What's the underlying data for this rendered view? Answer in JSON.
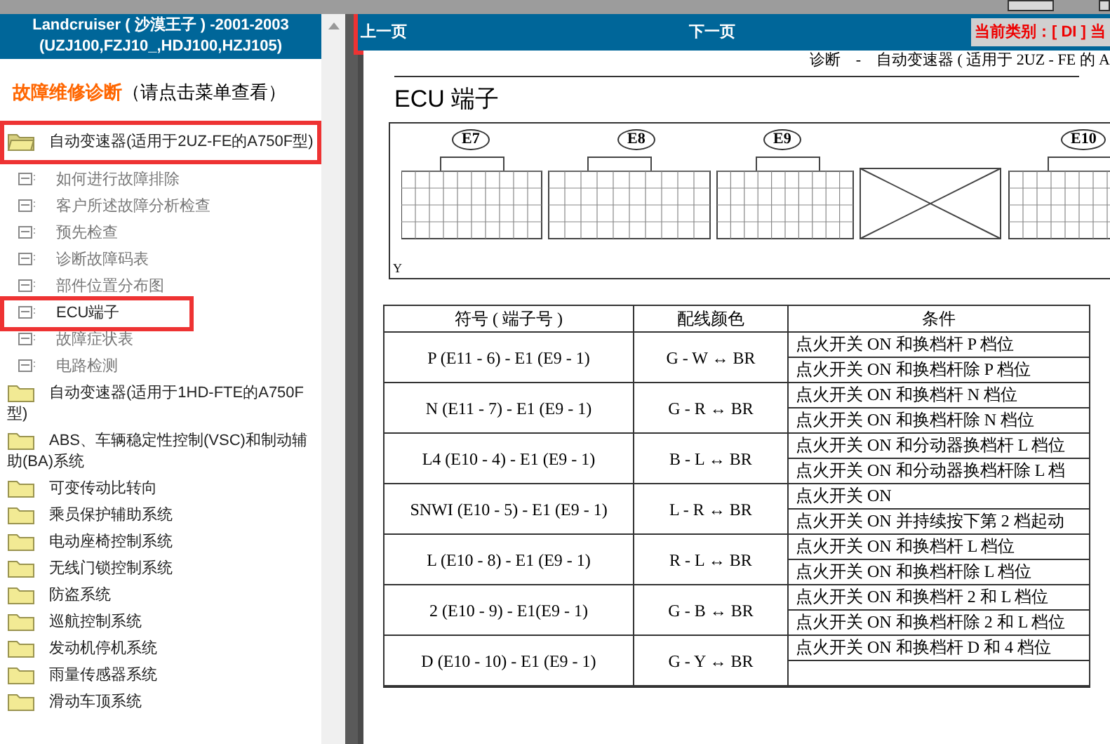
{
  "sidebar": {
    "title_lines": [
      "Landcruiser ( 沙漠王子 ) -2001-2003",
      "(UZJ100,FZJ10_,HDJ100,HZJ105)"
    ],
    "heading": "故障维修诊断",
    "heading_hint": "（请点击菜单查看）",
    "items": [
      {
        "label": "自动变速器(适用于2UZ-FE的A750F型)",
        "expanded": true,
        "highlighted": true,
        "children": [
          {
            "label": "如何进行故障排除",
            "highlighted": false
          },
          {
            "label": "客户所述故障分析检查",
            "highlighted": false
          },
          {
            "label": "预先检查",
            "highlighted": false
          },
          {
            "label": "诊断故障码表",
            "highlighted": false
          },
          {
            "label": "部件位置分布图",
            "highlighted": false
          },
          {
            "label": "ECU端子",
            "highlighted": true
          },
          {
            "label": "故障症状表",
            "highlighted": false
          },
          {
            "label": "电路检测",
            "highlighted": false
          }
        ]
      },
      {
        "label": "自动变速器(适用于1HD-FTE的A750F型)",
        "expanded": false,
        "highlighted": false
      },
      {
        "label": "ABS、车辆稳定性控制(VSC)和制动辅助(BA)系统",
        "expanded": false,
        "highlighted": false
      },
      {
        "label": "可变传动比转向",
        "expanded": false,
        "highlighted": false
      },
      {
        "label": "乘员保护辅助系统",
        "expanded": false,
        "highlighted": false
      },
      {
        "label": "电动座椅控制系统",
        "expanded": false,
        "highlighted": false
      },
      {
        "label": "无线门锁控制系统",
        "expanded": false,
        "highlighted": false
      },
      {
        "label": "防盗系统",
        "expanded": false,
        "highlighted": false
      },
      {
        "label": "巡航控制系统",
        "expanded": false,
        "highlighted": false
      },
      {
        "label": "发动机停机系统",
        "expanded": false,
        "highlighted": false
      },
      {
        "label": "雨量传感器系统",
        "expanded": false,
        "highlighted": false
      },
      {
        "label": "滑动车顶系统",
        "expanded": false,
        "highlighted": false
      }
    ]
  },
  "nav": {
    "prev": "上一页",
    "next": "下一页",
    "highlighted": true,
    "category": "当前类别：[ DI ] 当"
  },
  "document": {
    "running_head": "诊断　-　自动变速器 ( 适用于 2UZ - FE 的 A",
    "title": "ECU 端子",
    "connectors": [
      "E7",
      "E8",
      "E9",
      "E10"
    ],
    "corner_mark": "Y",
    "table": {
      "columns": [
        "符号 ( 端子号 )",
        "配线颜色",
        "条件"
      ],
      "rows": [
        {
          "symbol": "P (E11 - 6) - E1 (E9 - 1)",
          "wire": "G - W ↔ BR",
          "conditions": [
            "点火开关 ON 和换档杆 P 档位",
            "点火开关 ON 和换档杆除 P 档位"
          ]
        },
        {
          "symbol": "N (E11 - 7) - E1 (E9 - 1)",
          "wire": "G - R ↔ BR",
          "conditions": [
            "点火开关 ON 和换档杆 N 档位",
            "点火开关 ON 和换档杆除 N 档位"
          ]
        },
        {
          "symbol": "L4 (E10 - 4) - E1 (E9 - 1)",
          "wire": "B - L ↔ BR",
          "conditions": [
            "点火开关 ON 和分动器换档杆 L 档位",
            "点火开关 ON 和分动器换档杆除 L 档"
          ]
        },
        {
          "symbol": "SNWI (E10 - 5) - E1 (E9 - 1)",
          "wire": "L - R ↔ BR",
          "conditions": [
            "点火开关 ON",
            "点火开关 ON 并持续按下第 2 档起动"
          ]
        },
        {
          "symbol": "L (E10 - 8) - E1 (E9 - 1)",
          "wire": "R - L ↔ BR",
          "conditions": [
            "点火开关 ON 和换档杆 L 档位",
            "点火开关 ON 和换档杆除 L 档位"
          ]
        },
        {
          "symbol": "2 (E10 - 9) - E1(E9 - 1)",
          "wire": "G - B ↔ BR",
          "conditions": [
            "点火开关 ON 和换档杆 2 和 L 档位",
            "点火开关 ON 和换档杆除 2 和 L 档位"
          ]
        },
        {
          "symbol": "D (E10 - 10) - E1 (E9 - 1)",
          "wire": "G - Y ↔ BR",
          "conditions": [
            "点火开关 ON 和换档杆 D 和 4 档位"
          ]
        }
      ]
    }
  }
}
